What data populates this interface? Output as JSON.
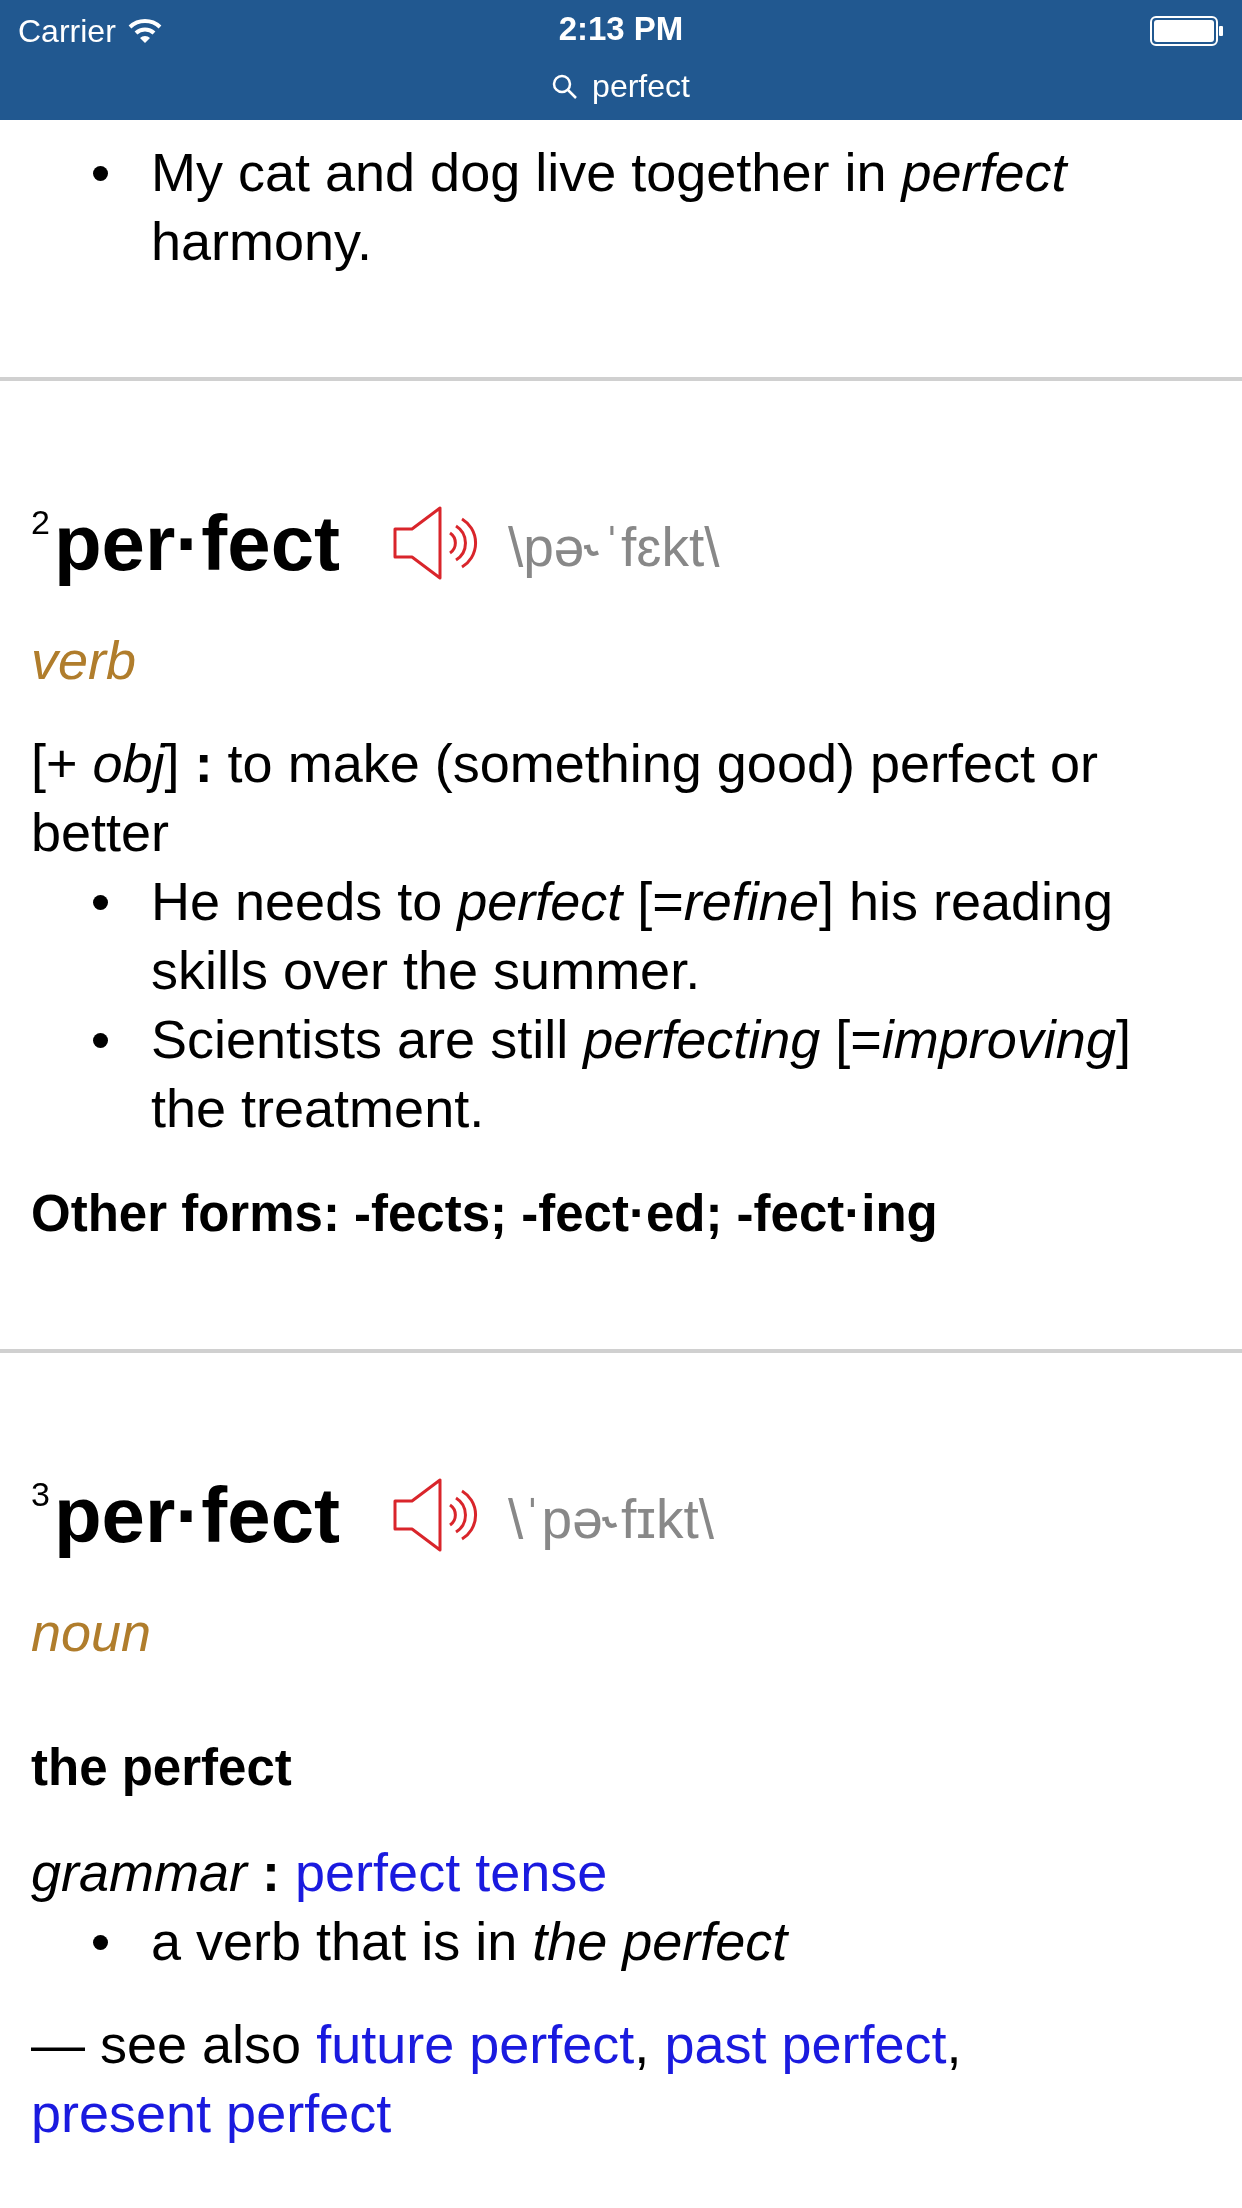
{
  "status_bar": {
    "carrier": "Carrier",
    "time": "2:13 PM"
  },
  "search_bar": {
    "query": "perfect"
  },
  "partial_entry": {
    "examples": [
      "My cat and dog live together in *perfect* harmony."
    ]
  },
  "entries": [
    {
      "homograph": "2",
      "headword": "per·fect",
      "pronunciation": "\\pə˞ˈfɛkt\\",
      "part_of_speech": "verb",
      "senses": [
        {
          "kind": "definition",
          "text": "[+ *obj*] **:** to make (something good) perfect or better",
          "examples": [
            "He needs to *perfect* [=*refine*] his reading skills over the summer.",
            "Scientists are still *perfecting* [=*improving*] the treatment."
          ]
        }
      ],
      "other_forms": "Other forms: -fects; -fect·ed; -fect·ing"
    },
    {
      "homograph": "3",
      "headword": "per·fect",
      "pronunciation": "\\ˈpə˞fɪkt\\",
      "part_of_speech": "noun",
      "senses": [
        {
          "kind": "phrase",
          "text": "the perfect"
        },
        {
          "kind": "label_link",
          "label": "grammar",
          "separator": ":",
          "link": "perfect tense",
          "examples": [
            "a verb that is in *the perfect*"
          ]
        }
      ],
      "see_also": {
        "lead": "— see also",
        "links": [
          {
            "text": "future perfect",
            "after": ","
          },
          {
            "text": "past perfect",
            "after": ","
          },
          {
            "text": "present perfect"
          }
        ]
      }
    }
  ]
}
